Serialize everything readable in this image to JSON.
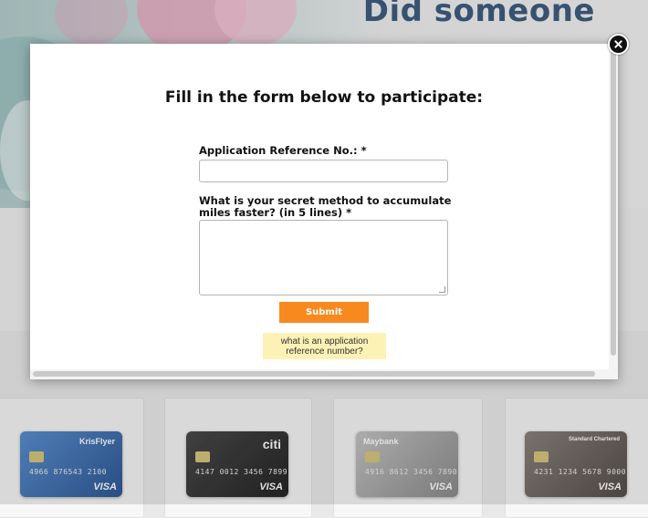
{
  "background": {
    "hero_heading": "Did someone",
    "cards": [
      {
        "brand": "KrisFlyer",
        "number": "4966 876543 2100",
        "network": "VISA",
        "color": "#3d6fa8"
      },
      {
        "brand": "citi",
        "number": "4147 0012 3456 7899",
        "network": "VISA",
        "color": "#3b3b3b"
      },
      {
        "brand": "Maybank",
        "number": "4916 8612 3456 7890",
        "network": "VISA",
        "color": "#9a9a9a"
      },
      {
        "brand": "Standard Chartered",
        "number": "4231 1234 5678 9000",
        "network": "VISA",
        "color": "#6c6560"
      }
    ]
  },
  "modal": {
    "title": "Fill in the form below to participate:",
    "fields": {
      "reference_label": "Application Reference No.: *",
      "reference_value": "",
      "method_label": "What is your secret method to accumulate miles faster? (in 5 lines) *",
      "method_value": ""
    },
    "submit_label": "Submit",
    "help_link": "what is an application reference number?",
    "close_icon": "close-icon"
  },
  "colors": {
    "accent": "#f7891e",
    "help_bg": "#fdf2b5",
    "heading_blue": "#3f5e80"
  }
}
